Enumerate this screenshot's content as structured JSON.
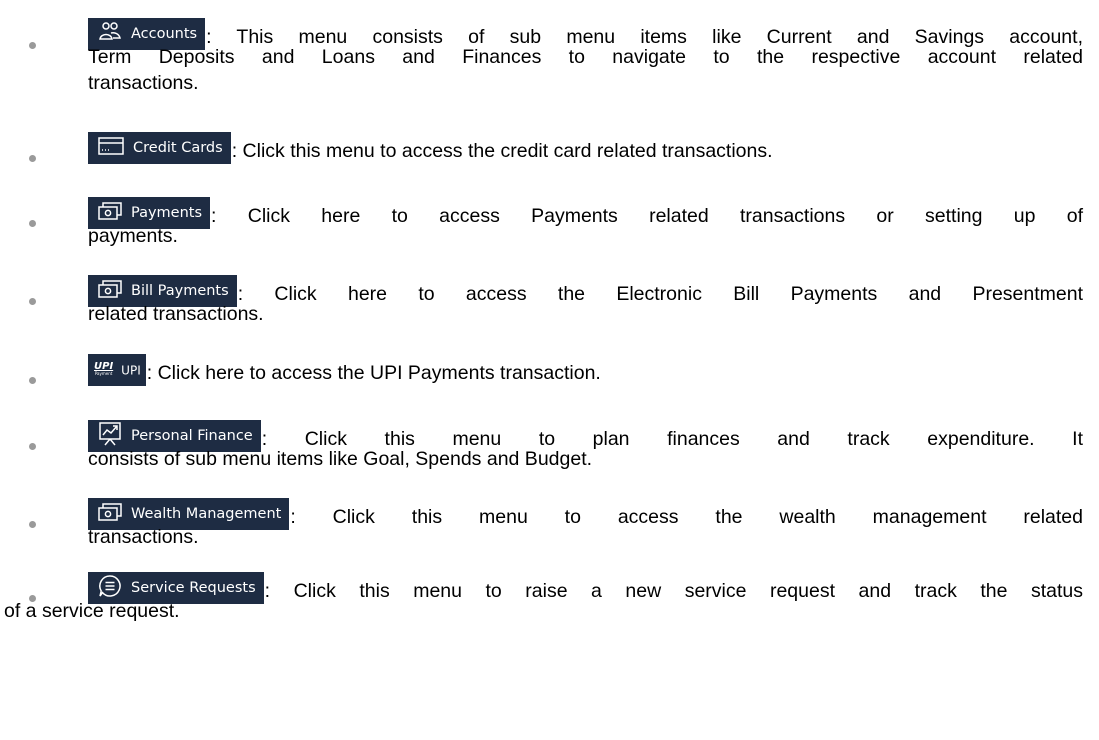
{
  "menu_items": [
    {
      "icon": "accounts-icon",
      "label": "Accounts",
      "line1": ": This menu consists of sub menu items like Current and Savings account,",
      "line2": "Term Deposits and Loans and Finances to navigate to the respective account related",
      "line3": "transactions."
    },
    {
      "icon": "credit-card-icon",
      "label": "Credit Cards",
      "line1": ": Click this menu to access the credit card related transactions."
    },
    {
      "icon": "payments-icon",
      "label": "Payments",
      "line1": ": Click here to access Payments related transactions or setting up of",
      "line2": "payments."
    },
    {
      "icon": "bill-payments-icon",
      "label": "Bill Payments",
      "line1": ": Click here to access the Electronic Bill Payments and Presentment",
      "line2": "related transactions."
    },
    {
      "icon": "upi-payment-icon",
      "icon_text": "UPI",
      "icon_subtext": "Payment",
      "label": "UPI",
      "line1": ": Click here to access the UPI Payments transaction."
    },
    {
      "icon": "personal-finance-chart-icon",
      "label": "Personal Finance",
      "line1": ": Click this menu to plan finances and track expenditure. It",
      "line2": "consists of sub menu items like Goal, Spends and Budget."
    },
    {
      "icon": "wealth-management-icon",
      "label": "Wealth Management",
      "line1": ": Click this menu to access the wealth management related",
      "line2": "transactions."
    },
    {
      "icon": "service-requests-chat-icon",
      "label": "Service Requests",
      "line1": ": Click this menu to raise a new service request and track the status",
      "line2": "of a service request."
    }
  ],
  "colors": {
    "badge_background": "#1e2c43",
    "badge_text": "#ffffff",
    "bullet": "#9a9a9a",
    "body_text": "#000000"
  }
}
